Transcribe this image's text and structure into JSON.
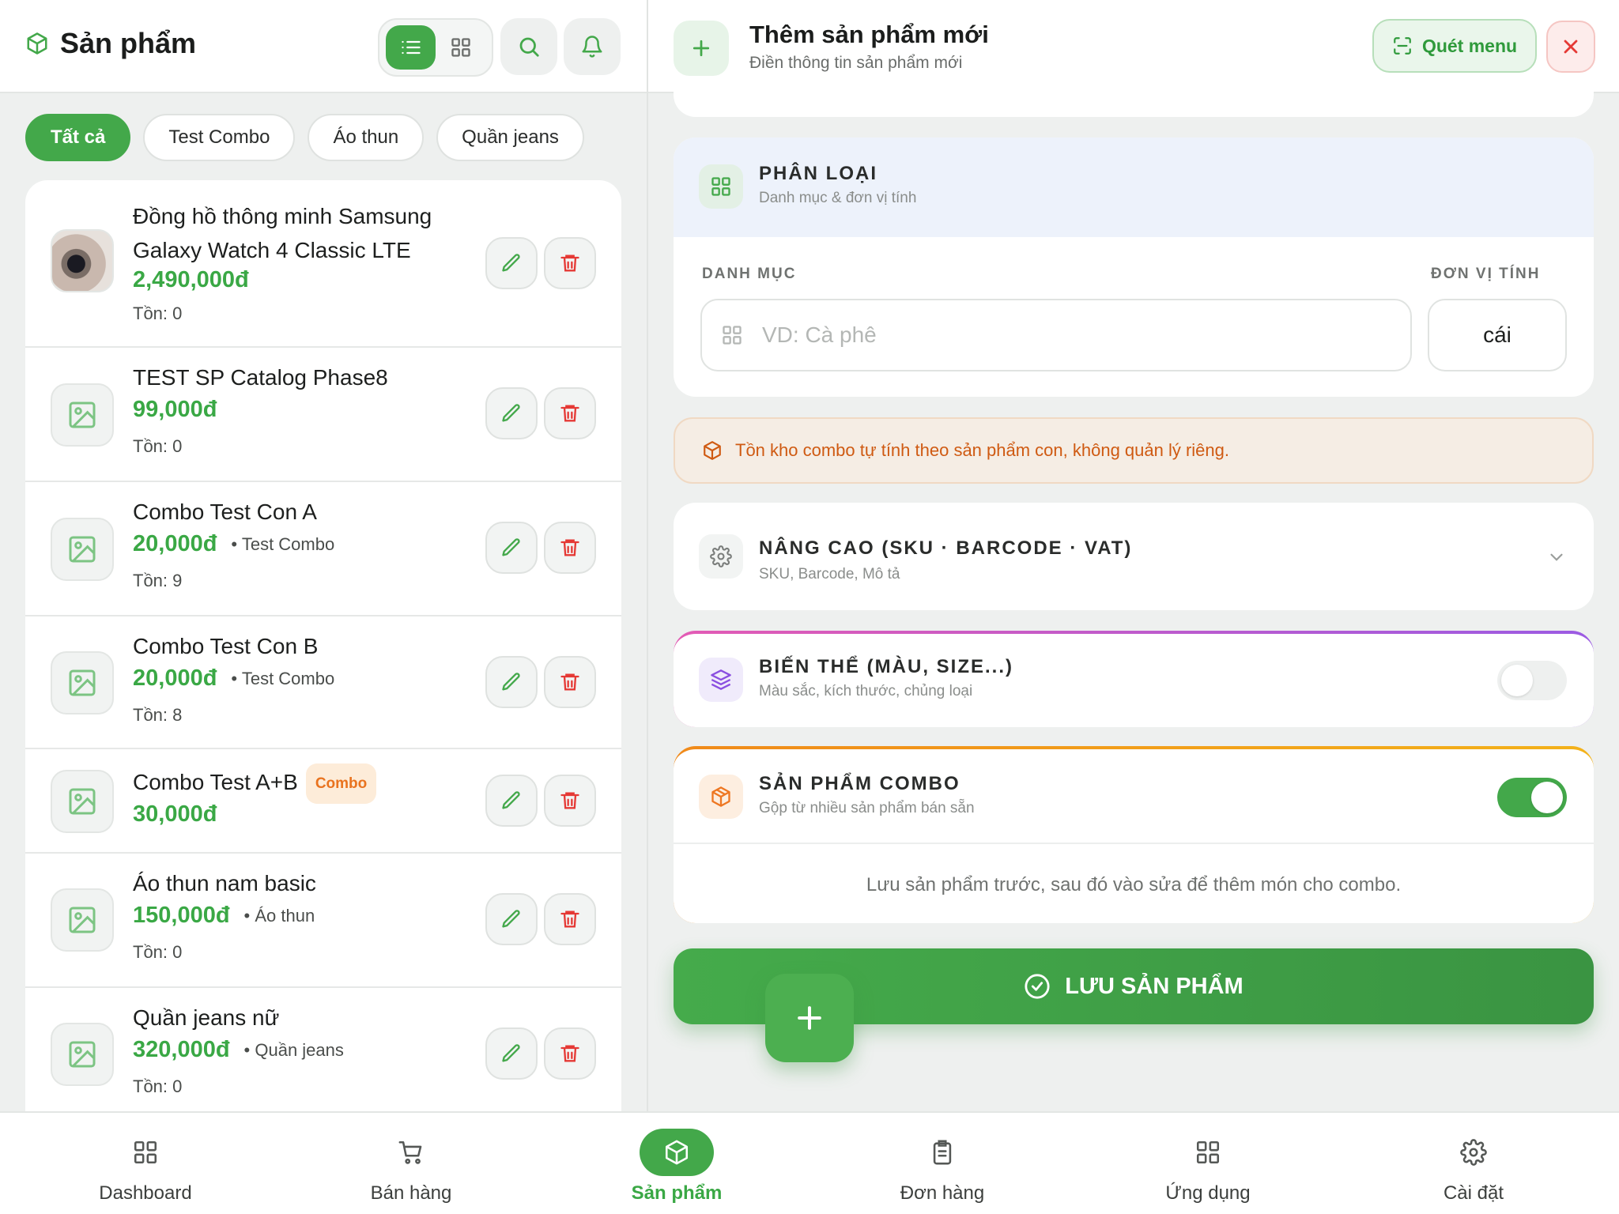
{
  "colors": {
    "accent": "#43a84a",
    "price": "#3aa845",
    "danger": "#e53935",
    "combo": "#e9731f",
    "notice_bg": "#f5ede4"
  },
  "left": {
    "title": "Sản phẩm",
    "title_icon": "box-icon",
    "chips": [
      "Tất cả",
      "Test Combo",
      "Áo thun",
      "Quần jeans"
    ],
    "active_chip": "Tất cả",
    "products": [
      {
        "name_line1": "Đồng hồ thông minh Samsung",
        "name_line2": "Galaxy Watch 4 Classic LTE",
        "price": "2,490,000đ",
        "category": "",
        "stock": "Tồn: 0",
        "badge": "",
        "has_photo": true
      },
      {
        "name_line1": "TEST SP Catalog Phase8",
        "name_line2": "",
        "price": "99,000đ",
        "category": "",
        "stock": "Tồn: 0",
        "badge": ""
      },
      {
        "name_line1": "Combo Test Con A",
        "name_line2": "",
        "price": "20,000đ",
        "category": "• Test Combo",
        "stock": "Tồn: 9",
        "badge": ""
      },
      {
        "name_line1": "Combo Test Con B",
        "name_line2": "",
        "price": "20,000đ",
        "category": "• Test Combo",
        "stock": "Tồn: 8",
        "badge": ""
      },
      {
        "name_line1": "Combo Test A+B",
        "name_line2": "",
        "price": "30,000đ",
        "category": "",
        "stock": "",
        "badge": "Combo"
      },
      {
        "name_line1": "Áo thun nam basic",
        "name_line2": "",
        "price": "150,000đ",
        "category": "• Áo thun",
        "stock": "Tồn: 0",
        "badge": ""
      },
      {
        "name_line1": "Quần jeans nữ",
        "name_line2": "",
        "price": "320,000đ",
        "category": "• Quần jeans",
        "stock": "Tồn: 0",
        "badge": ""
      }
    ]
  },
  "right": {
    "title": "Thêm sản phẩm mới",
    "subtitle": "Điền thông tin sản phẩm mới",
    "scan_label": "Quét menu",
    "classification": {
      "title": "PHÂN LOẠI",
      "subtitle": "Danh mục & đơn vị tính",
      "category_label": "DANH MỤC",
      "category_placeholder": "VD: Cà phê",
      "unit_label": "ĐƠN VỊ TÍNH",
      "unit_value": "cái"
    },
    "notice": "Tồn kho combo tự tính theo sản phẩm con, không quản lý riêng.",
    "advanced": {
      "title": "NÂNG CAO (SKU · BARCODE · VAT)",
      "subtitle": "SKU, Barcode, Mô tả"
    },
    "variants": {
      "title": "BIẾN THỂ (MÀU, SIZE...)",
      "subtitle": "Màu sắc, kích thước, chủng loại",
      "enabled": false
    },
    "combo": {
      "title": "SẢN PHẨM COMBO",
      "subtitle": "Gộp từ nhiều sản phẩm bán sẵn",
      "enabled": true,
      "hint": "Lưu sản phẩm trước, sau đó vào sửa để thêm món cho combo."
    },
    "save_label": "LƯU SẢN PHẨM"
  },
  "nav": [
    {
      "label": "Dashboard",
      "icon": "grid-icon",
      "active": false
    },
    {
      "label": "Bán hàng",
      "icon": "cart-icon",
      "active": false
    },
    {
      "label": "Sản phẩm",
      "icon": "box-icon",
      "active": true
    },
    {
      "label": "Đơn hàng",
      "icon": "clipboard-icon",
      "active": false
    },
    {
      "label": "Ứng dụng",
      "icon": "apps-icon",
      "active": false
    },
    {
      "label": "Cài đặt",
      "icon": "gear-icon",
      "active": false
    }
  ]
}
